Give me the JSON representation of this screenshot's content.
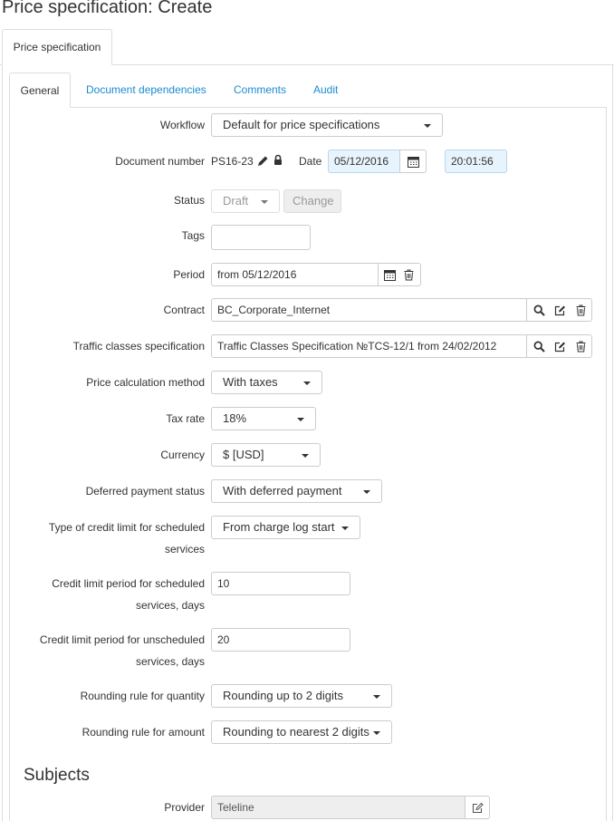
{
  "page": {
    "title": "Price specification: Create"
  },
  "outer_tabs": [
    {
      "label": "Price specification"
    }
  ],
  "inner_tabs": [
    {
      "label": "General"
    },
    {
      "label": "Document dependencies"
    },
    {
      "label": "Comments"
    },
    {
      "label": "Audit"
    }
  ],
  "form": {
    "workflow": {
      "label": "Workflow",
      "value": "Default for price specifications"
    },
    "document_number": {
      "label": "Document number",
      "value": "PS16-23"
    },
    "date": {
      "label": "Date",
      "value": "05/12/2016",
      "time": "20:01:56"
    },
    "status": {
      "label": "Status",
      "value": "Draft",
      "change_label": "Change"
    },
    "tags": {
      "label": "Tags",
      "value": ""
    },
    "period": {
      "label": "Period",
      "value": "from 05/12/2016"
    },
    "contract": {
      "label": "Contract",
      "value": "BC_Corporate_Internet"
    },
    "traffic_classes": {
      "label": "Traffic classes specification",
      "value": "Traffic Classes Specification №TCS-12/1 from 24/02/2012"
    },
    "price_calc_method": {
      "label": "Price calculation method",
      "value": "With taxes"
    },
    "tax_rate": {
      "label": "Tax rate",
      "value": "18%"
    },
    "currency": {
      "label": "Currency",
      "value": "$ [USD]"
    },
    "deferred_payment": {
      "label": "Deferred payment status",
      "value": "With deferred payment"
    },
    "credit_limit_type": {
      "label_line1": "Type of credit limit for scheduled",
      "label_line2": "services",
      "value": "From charge log start"
    },
    "credit_period_scheduled": {
      "label_line1": "Credit limit period for scheduled",
      "label_line2": "services, days",
      "value": "10"
    },
    "credit_period_unscheduled": {
      "label_line1": "Credit limit period for unscheduled",
      "label_line2": "services, days",
      "value": "20"
    },
    "rounding_quantity": {
      "label": "Rounding rule for quantity",
      "value": "Rounding up to 2 digits"
    },
    "rounding_amount": {
      "label": "Rounding rule for amount",
      "value": "Rounding to nearest 2 digits"
    }
  },
  "subjects": {
    "title": "Subjects",
    "provider": {
      "label": "Provider",
      "value": "Teleline"
    }
  },
  "icons": [
    "pencil-icon",
    "lock-icon",
    "calendar-icon",
    "trash-icon",
    "search-icon",
    "edit-icon"
  ]
}
